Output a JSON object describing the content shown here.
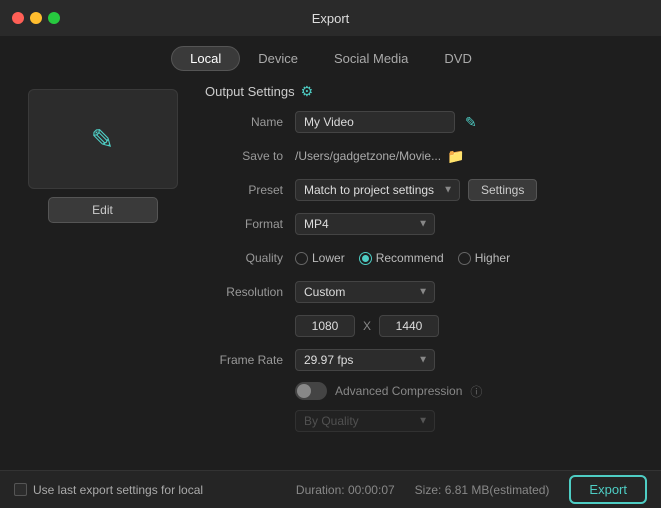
{
  "titleBar": {
    "title": "Export"
  },
  "tabs": [
    {
      "id": "local",
      "label": "Local",
      "active": true
    },
    {
      "id": "device",
      "label": "Device",
      "active": false
    },
    {
      "id": "social-media",
      "label": "Social Media",
      "active": false
    },
    {
      "id": "dvd",
      "label": "DVD",
      "active": false
    }
  ],
  "preview": {
    "edit_label": "Edit"
  },
  "outputSettings": {
    "section_title": "Output Settings",
    "name_label": "Name",
    "name_value": "My Video",
    "save_to_label": "Save to",
    "save_to_value": "/Users/gadgetzone/Movie...",
    "preset_label": "Preset",
    "preset_value": "Match to project settings",
    "settings_btn_label": "Settings",
    "format_label": "Format",
    "format_value": "MP4",
    "quality_label": "Quality",
    "quality_options": [
      {
        "id": "lower",
        "label": "Lower",
        "selected": false
      },
      {
        "id": "recommend",
        "label": "Recommend",
        "selected": true
      },
      {
        "id": "higher",
        "label": "Higher",
        "selected": false
      }
    ],
    "resolution_label": "Resolution",
    "resolution_value": "Custom",
    "resolution_w": "1080",
    "resolution_x": "X",
    "resolution_h": "1440",
    "frame_rate_label": "Frame Rate",
    "frame_rate_value": "29.97 fps",
    "advanced_label": "Advanced Compression",
    "by_quality_label": "By Quality"
  },
  "bottomBar": {
    "checkbox_label": "Use last export settings for local",
    "duration_label": "Duration:",
    "duration_value": "00:00:07",
    "size_label": "Size:",
    "size_value": "6.81 MB(estimated)",
    "export_label": "Export"
  }
}
